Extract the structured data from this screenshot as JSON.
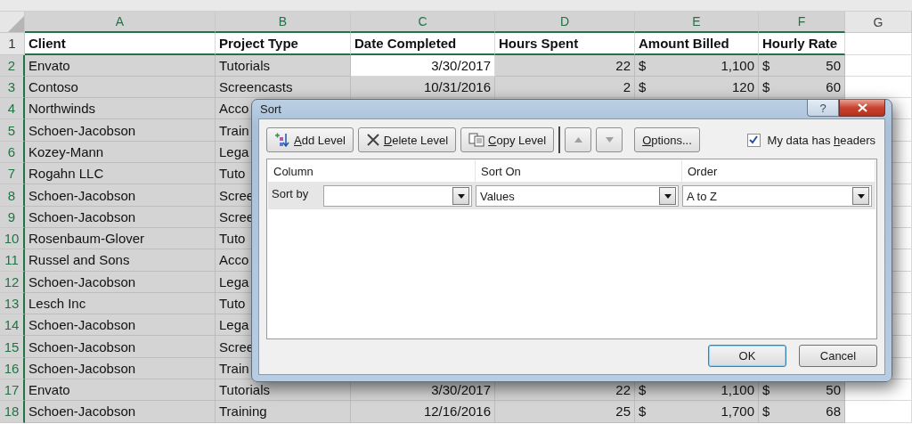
{
  "spreadsheet": {
    "columns": [
      {
        "letter": "A",
        "kind": "text"
      },
      {
        "letter": "B",
        "kind": "text"
      },
      {
        "letter": "C",
        "kind": "number"
      },
      {
        "letter": "D",
        "kind": "number"
      },
      {
        "letter": "E",
        "kind": "currency"
      },
      {
        "letter": "F",
        "kind": "currency"
      },
      {
        "letter": "G"
      }
    ],
    "rows": [
      {
        "number": "1",
        "header": true,
        "selected": false,
        "cells": [
          "Client",
          "Project Type",
          "Date Completed",
          "Hours Spent",
          "Amount Billed",
          "Hourly Rate"
        ]
      },
      {
        "number": "2",
        "header": false,
        "selected": true,
        "cells": [
          "Envato",
          "Tutorials",
          {
            "value": "3/30/2017",
            "active": true
          },
          "22",
          {
            "currency": "$",
            "amount": "1,100"
          },
          {
            "currency": "$",
            "amount": "50"
          }
        ]
      },
      {
        "number": "3",
        "header": false,
        "selected": true,
        "cells": [
          "Contoso",
          "Screencasts",
          "10/31/2016",
          "2",
          {
            "currency": "$",
            "amount": "120"
          },
          {
            "currency": "$",
            "amount": "60"
          }
        ]
      },
      {
        "number": "4",
        "header": false,
        "selected": true,
        "cells": [
          "Northwinds",
          "Acco"
        ]
      },
      {
        "number": "5",
        "header": false,
        "selected": true,
        "cells": [
          "Schoen-Jacobson",
          "Train"
        ]
      },
      {
        "number": "6",
        "header": false,
        "selected": true,
        "cells": [
          "Kozey-Mann",
          "Lega"
        ]
      },
      {
        "number": "7",
        "header": false,
        "selected": true,
        "cells": [
          "Rogahn LLC",
          "Tuto"
        ]
      },
      {
        "number": "8",
        "header": false,
        "selected": true,
        "cells": [
          "Schoen-Jacobson",
          "Scree"
        ]
      },
      {
        "number": "9",
        "header": false,
        "selected": true,
        "cells": [
          "Schoen-Jacobson",
          "Scree"
        ]
      },
      {
        "number": "10",
        "header": false,
        "selected": true,
        "cells": [
          "Rosenbaum-Glover",
          "Tuto"
        ]
      },
      {
        "number": "11",
        "header": false,
        "selected": true,
        "cells": [
          "Russel and Sons",
          "Acco"
        ]
      },
      {
        "number": "12",
        "header": false,
        "selected": true,
        "cells": [
          "Schoen-Jacobson",
          "Lega"
        ]
      },
      {
        "number": "13",
        "header": false,
        "selected": true,
        "cells": [
          "Lesch Inc",
          "Tuto"
        ]
      },
      {
        "number": "14",
        "header": false,
        "selected": true,
        "cells": [
          "Schoen-Jacobson",
          "Lega"
        ]
      },
      {
        "number": "15",
        "header": false,
        "selected": true,
        "cells": [
          "Schoen-Jacobson",
          "Scree"
        ]
      },
      {
        "number": "16",
        "header": false,
        "selected": true,
        "cells": [
          "Schoen-Jacobson",
          "Train"
        ]
      },
      {
        "number": "17",
        "header": false,
        "selected": true,
        "cells": [
          "Envato",
          "Tutorials",
          "3/30/2017",
          "22",
          {
            "currency": "$",
            "amount": "1,100"
          },
          {
            "currency": "$",
            "amount": "50"
          }
        ]
      },
      {
        "number": "18",
        "header": false,
        "selected": true,
        "cells": [
          "Schoen-Jacobson",
          "Training",
          "12/16/2016",
          "25",
          {
            "currency": "$",
            "amount": "1,700"
          },
          {
            "currency": "$",
            "amount": "68"
          }
        ]
      }
    ]
  },
  "dialog": {
    "title": "Sort",
    "help": "?",
    "toolbar": [
      {
        "kind": "add",
        "label": {
          "key": "A",
          "rest": "dd Level"
        },
        "disabled": false
      },
      {
        "kind": "delete",
        "label": {
          "key": "D",
          "rest": "elete Level"
        },
        "disabled": false
      },
      {
        "kind": "copy",
        "label": {
          "key": "C",
          "rest": "opy Level"
        },
        "disabled": false
      },
      {
        "kind": "up",
        "disabled": true
      },
      {
        "kind": "down",
        "disabled": true
      },
      {
        "kind": "options",
        "label": {
          "key": "O",
          "rest": "ptions..."
        },
        "disabled": false
      }
    ],
    "headers_checkbox": {
      "label": {
        "before": "My data has ",
        "key": "h",
        "rest": "eaders"
      },
      "checked": true
    },
    "grid_headers": [
      "Column",
      "Sort On",
      "Order"
    ],
    "levels": [
      {
        "label": "Sort by",
        "selected": true,
        "sort_on": "Values",
        "order": "A to Z"
      }
    ],
    "buttons": [
      {
        "label": "OK",
        "default": true
      },
      {
        "label": "Cancel",
        "default": false
      }
    ]
  }
}
